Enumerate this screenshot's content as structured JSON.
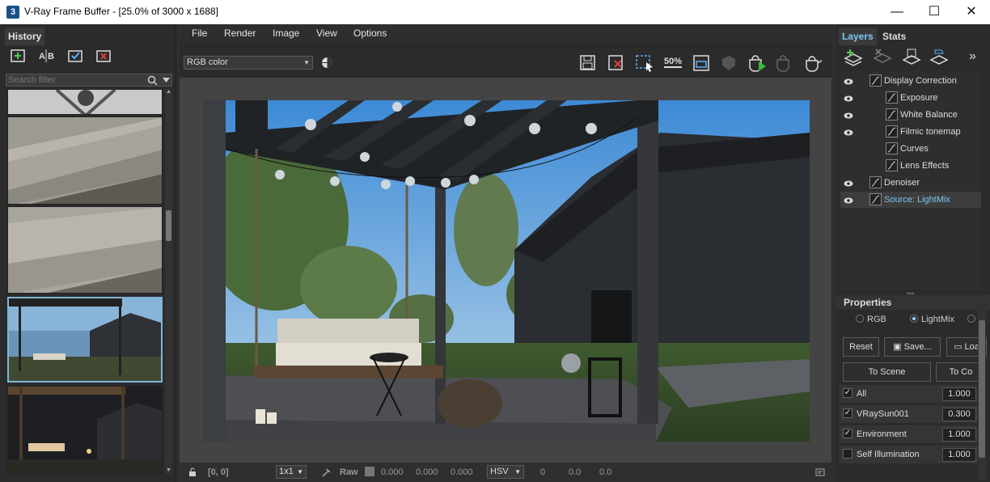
{
  "window": {
    "title": "V-Ray Frame Buffer - [25.0% of 3000 x 1688]",
    "app_icon": "3",
    "minimize": "—",
    "maximize": "☐",
    "close": "✕"
  },
  "history": {
    "tab": "History",
    "search_placeholder": "Search filter"
  },
  "menu": [
    "File",
    "Render",
    "Image",
    "View",
    "Options"
  ],
  "toolbar": {
    "channel": "RGB color",
    "zoom_label": "50%"
  },
  "status": {
    "coords": "[0, 0]",
    "scale": "1x1",
    "raw": "Raw",
    "r": "0.000",
    "g": "0.000",
    "b": "0.000",
    "colorspace": "HSV",
    "h": "0",
    "s": "0.0",
    "v": "0.0"
  },
  "layers_panel": {
    "tabs": [
      "Layers",
      "Stats"
    ],
    "items": [
      {
        "name": "Display Correction",
        "visible": true,
        "indent": 0
      },
      {
        "name": "Exposure",
        "visible": true,
        "indent": 1
      },
      {
        "name": "White Balance",
        "visible": true,
        "indent": 1
      },
      {
        "name": "Filmic tonemap",
        "visible": true,
        "indent": 1
      },
      {
        "name": "Curves",
        "visible": false,
        "indent": 1
      },
      {
        "name": "Lens Effects",
        "visible": false,
        "indent": 1
      },
      {
        "name": "Denoiser",
        "visible": true,
        "indent": 0
      },
      {
        "name": "Source: LightMix",
        "visible": true,
        "indent": 0,
        "selected": true
      }
    ]
  },
  "properties": {
    "title": "Properties",
    "modes": [
      "RGB",
      "LightMix"
    ],
    "selected_mode": "LightMix",
    "buttons": {
      "reset": "Reset",
      "save": "Save...",
      "load": "Loa",
      "to_scene": "To Scene",
      "to_co": "To Co"
    },
    "lights": [
      {
        "name": "All",
        "value": "1.000",
        "checked": true
      },
      {
        "name": "VRaySun001",
        "value": "0.300",
        "checked": true
      },
      {
        "name": "Environment",
        "value": "1.000",
        "checked": true
      },
      {
        "name": "Self Illumination",
        "value": "1.000",
        "checked": false
      }
    ]
  },
  "colors": {
    "accent": "#7ec6f0",
    "panel": "#2b2b2b",
    "viewport": "#444444"
  }
}
